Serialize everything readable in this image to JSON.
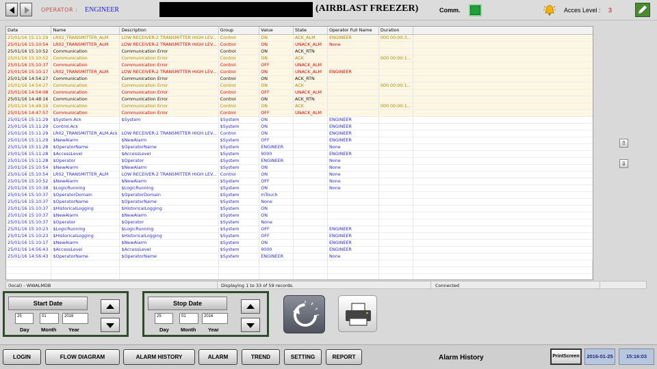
{
  "header": {
    "operator_label": "OPERATOR :",
    "operator_value": "ENGINEER",
    "title": "(AIRBLAST FREEZER)",
    "comm_label": "Comm.",
    "access_label": "Acces Level :",
    "access_value": "3",
    "colors": {
      "comm_led": "#1fa23b",
      "bell": "#f5b400"
    }
  },
  "table": {
    "columns": [
      "Date",
      "Name",
      "Description",
      "Group",
      "Value",
      "State",
      "Operator Full Name",
      "Duration"
    ],
    "rows": [
      {
        "date": "25/01/16 15:11:29",
        "name": "LR02_TRANSMITTER_ALM",
        "desc": "LOW RECEIVER-2 TRANSMITTER HIGH LEV...",
        "group": "Control",
        "value": "ON",
        "state": "ACK_ALM",
        "op": "ENGINEER",
        "dur": "000 00:00:3...",
        "color": "yel"
      },
      {
        "date": "25/01/16 15:10:54",
        "name": "LR02_TRANSMITTER_ALM",
        "desc": "LOW RECEIVER-2 TRANSMITTER HIGH LEV...",
        "group": "Control",
        "value": "ON",
        "state": "UNACK_ALM",
        "op": "None",
        "dur": "",
        "color": "red"
      },
      {
        "date": "25/01/16 15:10:52",
        "name": "Communication",
        "desc": "Communication Error",
        "group": "Control",
        "value": "ON",
        "state": "ACK_RTN",
        "op": "",
        "dur": "",
        "color": "blk"
      },
      {
        "date": "25/01/16 15:10:52",
        "name": "Communication",
        "desc": "Communication Error",
        "group": "Control",
        "value": "ON",
        "state": "ACK",
        "op": "",
        "dur": "000 00:00:1...",
        "color": "yel"
      },
      {
        "date": "25/01/16 15:10:37",
        "name": "Communication",
        "desc": "Communication Error",
        "group": "Control",
        "value": "OFF",
        "state": "UNACK_ALM",
        "op": "",
        "dur": "",
        "color": "red"
      },
      {
        "date": "25/01/16 15:10:17",
        "name": "LR02_TRANSMITTER_ALM",
        "desc": "LOW RECEIVER-2 TRANSMITTER HIGH LEV...",
        "group": "Control",
        "value": "ON",
        "state": "UNACK_ALM",
        "op": "ENGINEER",
        "dur": "",
        "color": "red"
      },
      {
        "date": "25/01/16 14:54:27",
        "name": "Communication",
        "desc": "Communication Error",
        "group": "Control",
        "value": "ON",
        "state": "ACK_RTN",
        "op": "",
        "dur": "",
        "color": "blk"
      },
      {
        "date": "25/01/16 14:54:27",
        "name": "Communication",
        "desc": "Communication Error",
        "group": "Control",
        "value": "ON",
        "state": "ACK",
        "op": "",
        "dur": "000 00:00:1...",
        "color": "yel"
      },
      {
        "date": "25/01/16 14:54:08",
        "name": "Communication",
        "desc": "Communication Error",
        "group": "Control",
        "value": "OFF",
        "state": "UNACK_ALM",
        "op": "",
        "dur": "",
        "color": "red"
      },
      {
        "date": "25/01/16 14:48:16",
        "name": "Communication",
        "desc": "Communication Error",
        "group": "Control",
        "value": "ON",
        "state": "ACK_RTN",
        "op": "",
        "dur": "",
        "color": "blk"
      },
      {
        "date": "25/01/16 14:48:16",
        "name": "Communication",
        "desc": "Communication Error",
        "group": "Control",
        "value": "ON",
        "state": "ACK",
        "op": "",
        "dur": "000 00:00:1...",
        "color": "yel"
      },
      {
        "date": "25/01/16 14:47:57",
        "name": "Communication",
        "desc": "Communication Error",
        "group": "Control",
        "value": "OFF",
        "state": "UNACK_ALM",
        "op": "",
        "dur": "",
        "color": "red"
      },
      {
        "date": "25/01/16 15:11:29",
        "name": "$System.Ack",
        "desc": "$System",
        "group": "$System",
        "value": "ON",
        "state": "",
        "op": "ENGINEER",
        "dur": "",
        "color": "blu"
      },
      {
        "date": "25/01/16 15:11:29",
        "name": "Control.Ack",
        "desc": "",
        "group": "$System",
        "value": "ON",
        "state": "",
        "op": "ENGINEER",
        "dur": "",
        "color": "blu"
      },
      {
        "date": "25/01/16 15:11:29",
        "name": "LR02_TRANSMITTER_ALM.Ack",
        "desc": "LOW RECEIVER-2 TRANSMITTER HIGH LEV...",
        "group": "Control",
        "value": "ON",
        "state": "",
        "op": "ENGINEER",
        "dur": "",
        "color": "blu"
      },
      {
        "date": "25/01/16 15:11:29",
        "name": "$NewAlarm",
        "desc": "$NewAlarm",
        "group": "$System",
        "value": "OFF",
        "state": "",
        "op": "ENGINEER",
        "dur": "",
        "color": "blu"
      },
      {
        "date": "25/01/16 15:11:28",
        "name": "$OperatorName",
        "desc": "$OperatorName",
        "group": "$System",
        "value": "ENGINEER",
        "state": "",
        "op": "None",
        "dur": "",
        "color": "blu"
      },
      {
        "date": "25/01/16 15:11:28",
        "name": "$AccessLevel",
        "desc": "$AccessLevel",
        "group": "$System",
        "value": "9000",
        "state": "",
        "op": "ENGINEER",
        "dur": "",
        "color": "blu"
      },
      {
        "date": "25/01/16 15:11:28",
        "name": "$Operator",
        "desc": "$Operator",
        "group": "$System",
        "value": "ENGINEER",
        "state": "",
        "op": "None",
        "dur": "",
        "color": "blu"
      },
      {
        "date": "25/01/16 15:10:54",
        "name": "$NewAlarm",
        "desc": "$NewAlarm",
        "group": "$System",
        "value": "ON",
        "state": "",
        "op": "None",
        "dur": "",
        "color": "blu"
      },
      {
        "date": "25/01/16 15:10:54",
        "name": "LR02_TRANSMITTER_ALM",
        "desc": "LOW RECEIVER-2 TRANSMITTER HIGH LEV...",
        "group": "Control",
        "value": "ON",
        "state": "",
        "op": "None",
        "dur": "",
        "color": "blu"
      },
      {
        "date": "25/01/16 15:10:52",
        "name": "$NewAlarm",
        "desc": "$NewAlarm",
        "group": "$System",
        "value": "OFF",
        "state": "",
        "op": "None",
        "dur": "",
        "color": "blu"
      },
      {
        "date": "25/01/16 15:10:38",
        "name": "$LogicRunning",
        "desc": "$LogicRunning",
        "group": "$System",
        "value": "ON",
        "state": "",
        "op": "None",
        "dur": "",
        "color": "blu"
      },
      {
        "date": "25/01/16 15:10:37",
        "name": "$OperatorDomain",
        "desc": "$OperatorDomain",
        "group": "$System",
        "value": "InTouch",
        "state": "",
        "op": "",
        "dur": "",
        "color": "blu"
      },
      {
        "date": "25/01/16 15:10:37",
        "name": "$OperatorName",
        "desc": "$OperatorName",
        "group": "$System",
        "value": "None",
        "state": "",
        "op": "",
        "dur": "",
        "color": "blu"
      },
      {
        "date": "25/01/16 15:10:37",
        "name": "$HistoricalLogging",
        "desc": "$HistoricalLogging",
        "group": "$System",
        "value": "ON",
        "state": "",
        "op": "",
        "dur": "",
        "color": "blu"
      },
      {
        "date": "25/01/16 15:10:37",
        "name": "$NewAlarm",
        "desc": "$NewAlarm",
        "group": "$System",
        "value": "ON",
        "state": "",
        "op": "",
        "dur": "",
        "color": "blu"
      },
      {
        "date": "25/01/16 15:10:37",
        "name": "$Operator",
        "desc": "$Operator",
        "group": "$System",
        "value": "None",
        "state": "",
        "op": "",
        "dur": "",
        "color": "blu"
      },
      {
        "date": "25/01/16 15:10:23",
        "name": "$LogicRunning",
        "desc": "$LogicRunning",
        "group": "$System",
        "value": "OFF",
        "state": "",
        "op": "ENGINEER",
        "dur": "",
        "color": "blu"
      },
      {
        "date": "25/01/16 15:10:23",
        "name": "$HistoricalLogging",
        "desc": "$HistoricalLogging",
        "group": "$System",
        "value": "OFF",
        "state": "",
        "op": "ENGINEER",
        "dur": "",
        "color": "blu"
      },
      {
        "date": "25/01/16 15:10:17",
        "name": "$NewAlarm",
        "desc": "$NewAlarm",
        "group": "$System",
        "value": "ON",
        "state": "",
        "op": "ENGINEER",
        "dur": "",
        "color": "blu"
      },
      {
        "date": "25/01/16 14:56:43",
        "name": "$AccessLevel",
        "desc": "$AccessLevel",
        "group": "$System",
        "value": "9000",
        "state": "",
        "op": "ENGINEER",
        "dur": "",
        "color": "blu"
      },
      {
        "date": "25/01/16 14:56:43",
        "name": "$OperatorName",
        "desc": "$OperatorName",
        "group": "$System",
        "value": "ENGINEER",
        "state": "",
        "op": "None",
        "dur": "",
        "color": "blu"
      }
    ],
    "text_colors": {
      "yel": "#a38a00",
      "red": "#e00000",
      "blk": "#111111",
      "blu": "#2a2ac8"
    }
  },
  "statusbar": {
    "node": "(local) - WWALMDB",
    "records": "Displaying 1 to 33 of 59 records.",
    "connection": "Connected"
  },
  "start_date": {
    "title": "Start Date",
    "day": "25",
    "month": "01",
    "year": "2016",
    "day_label": "Day",
    "month_label": "Month",
    "year_label": "Year"
  },
  "stop_date": {
    "title": "Stop Date",
    "day": "25",
    "month": "01",
    "year": "2016",
    "day_label": "Day",
    "month_label": "Month",
    "year_label": "Year"
  },
  "nav": {
    "buttons": [
      "LOGIN",
      "FLOW DIAGRAM",
      "ALARM HISTORY",
      "ALARM",
      "TREND",
      "SETTING",
      "REPORT"
    ],
    "screen_title": "Alarm History",
    "printscreen": "PrintScreen",
    "date": "2016-01-25",
    "time": "15:16:03"
  }
}
